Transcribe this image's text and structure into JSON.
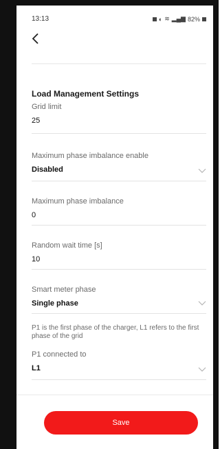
{
  "status_bar": {
    "time": "13:13",
    "battery": "82%"
  },
  "header": {
    "back_icon": "chevron-left-icon"
  },
  "section": {
    "title": "Load Management Settings"
  },
  "fields": {
    "grid_limit": {
      "label": "Grid limit",
      "value": "25"
    },
    "phase_imbalance_enable": {
      "label": "Maximum phase imbalance enable",
      "value": "Disabled"
    },
    "phase_imbalance": {
      "label": "Maximum phase imbalance",
      "value": "0"
    },
    "random_wait": {
      "label": "Random wait time [s]",
      "value": "10"
    },
    "smart_meter_phase": {
      "label": "Smart meter phase",
      "value": "Single phase"
    },
    "info_text": "P1 is the first phase of the charger, L1 refers to the first phase of the grid",
    "p1_connected": {
      "label": "P1 connected to",
      "value": "L1"
    }
  },
  "actions": {
    "save_label": "Save"
  },
  "colors": {
    "accent": "#f21a1a",
    "text": "#1a1a1a",
    "muted": "#6a6a6a",
    "divider": "#e3e3e3"
  }
}
